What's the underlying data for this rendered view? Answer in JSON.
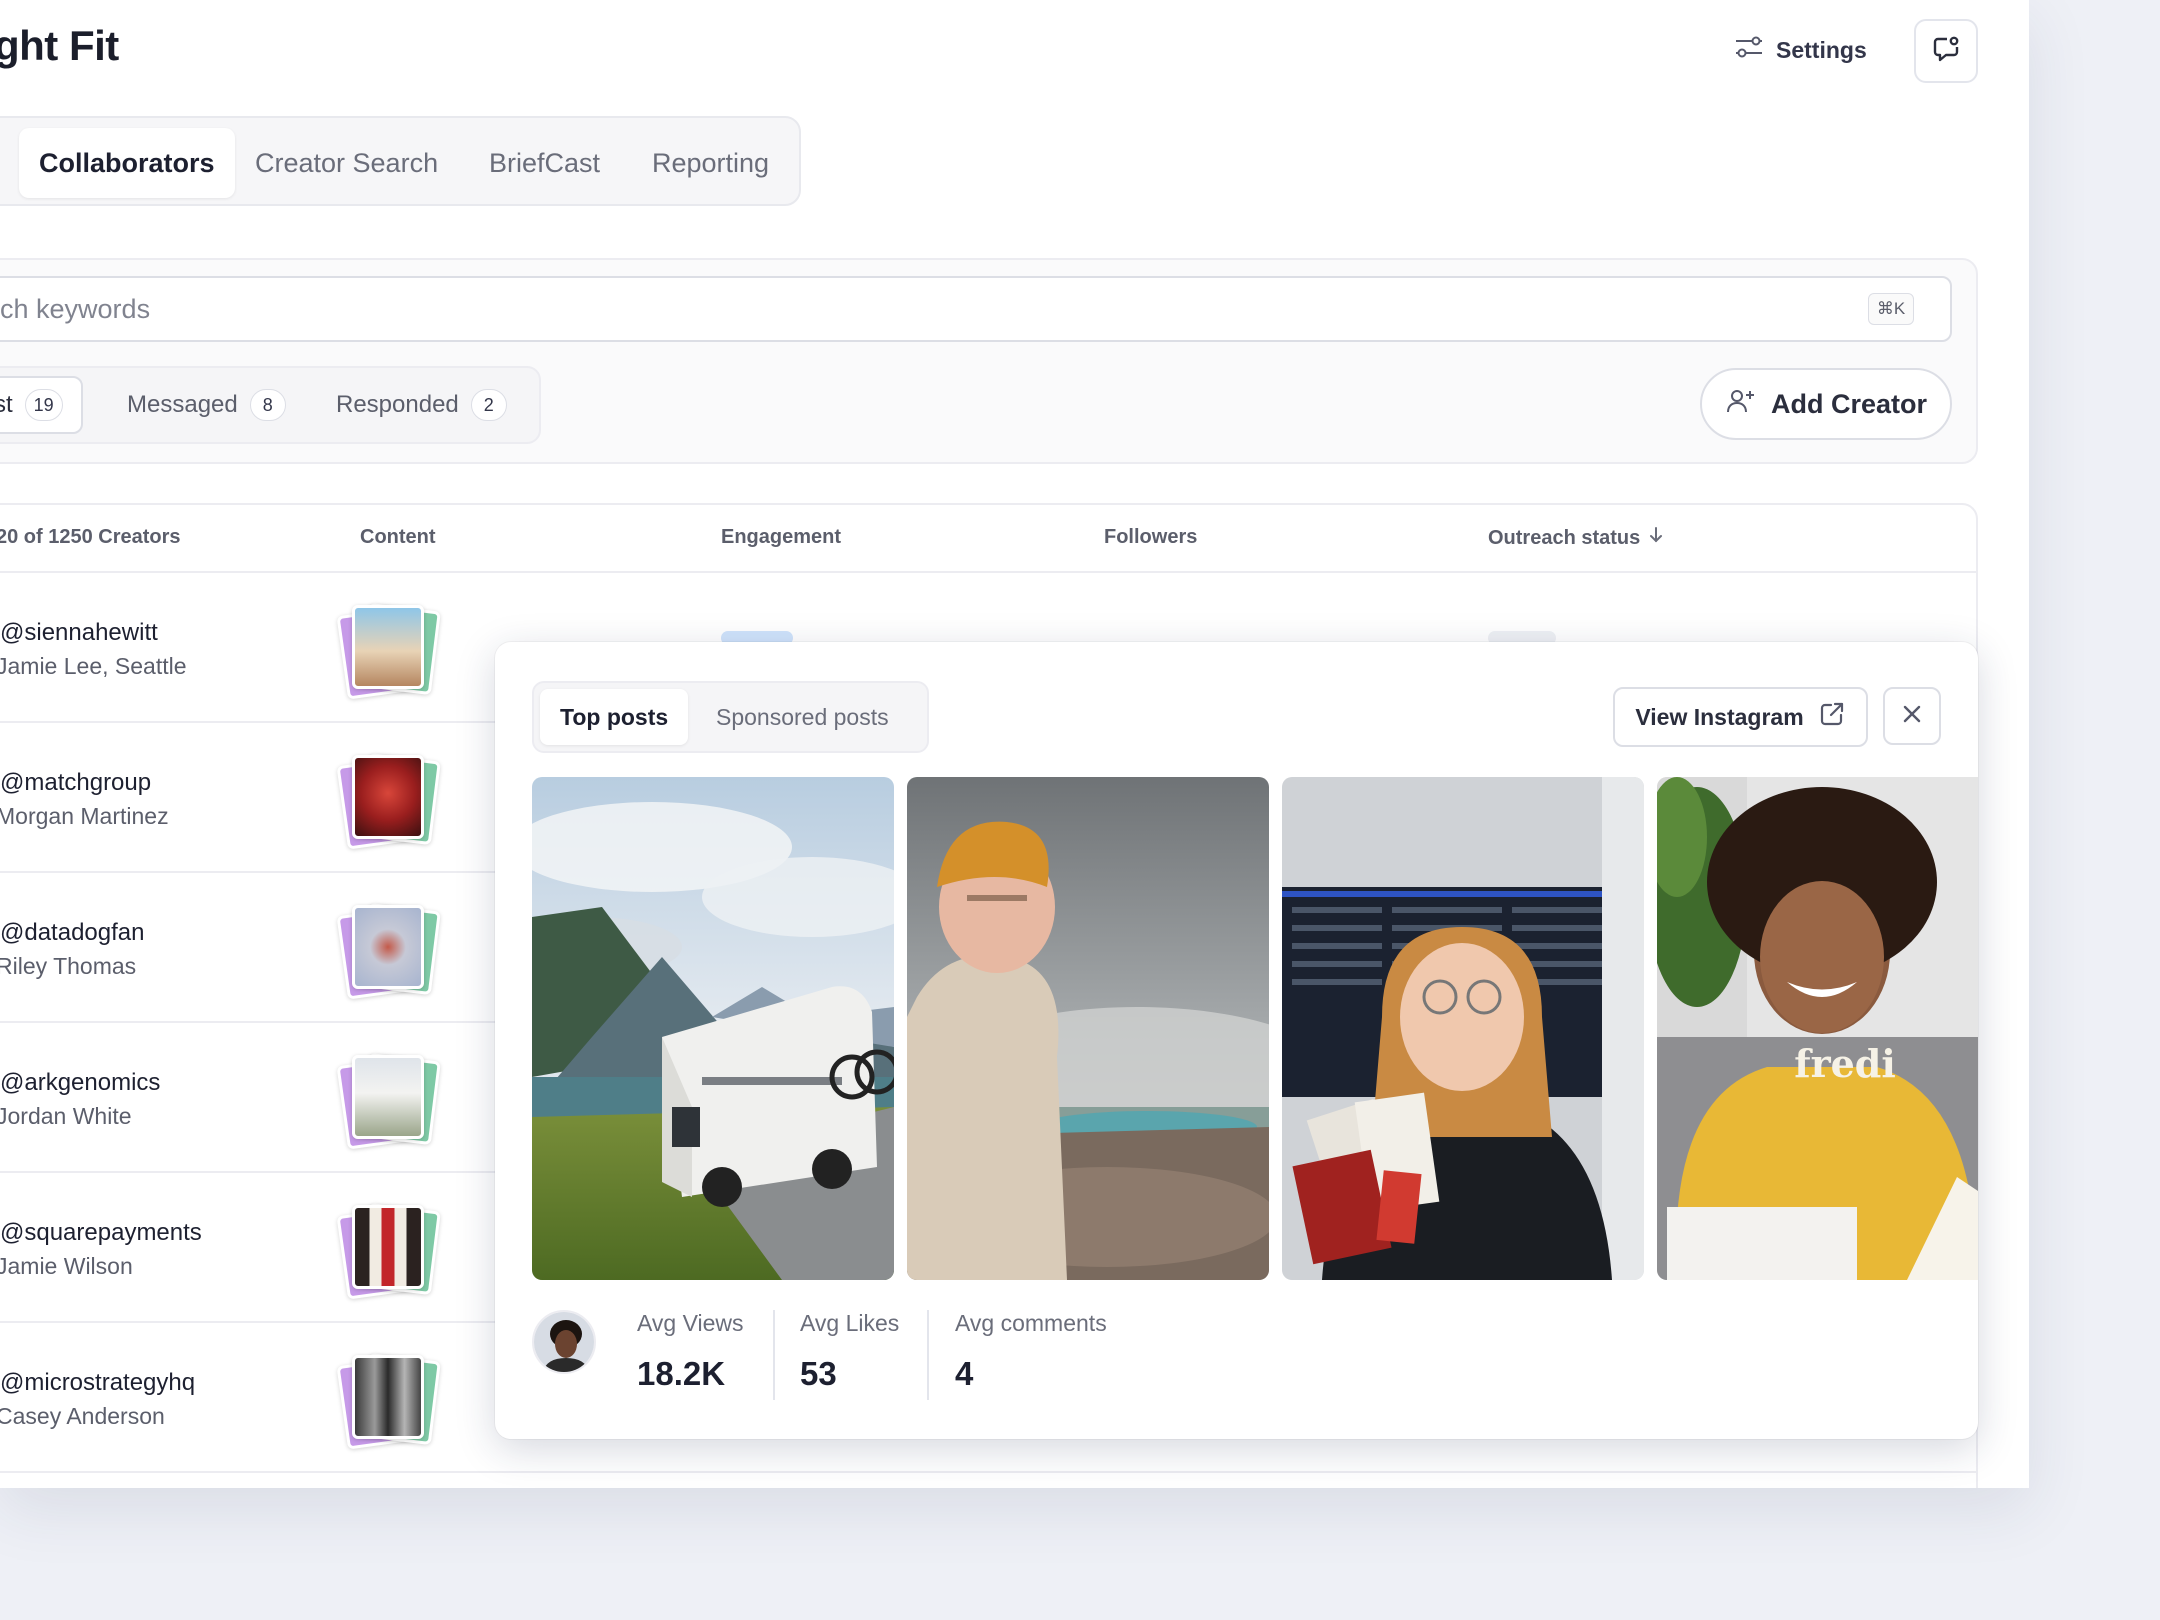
{
  "header": {
    "title": "ght Fit",
    "settings_label": "Settings"
  },
  "tabs": [
    {
      "label": "Collaborators",
      "active": true
    },
    {
      "label": "Creator Search"
    },
    {
      "label": "BriefCast"
    },
    {
      "label": "Reporting"
    }
  ],
  "search": {
    "placeholder": "arch keywords",
    "shortcut": "⌘K"
  },
  "segments": [
    {
      "label": "st",
      "count": "19",
      "active": true
    },
    {
      "label": "Messaged",
      "count": "8"
    },
    {
      "label": "Responded",
      "count": "2"
    }
  ],
  "add_creator_label": "Add Creator",
  "table": {
    "columns": [
      "20 of 1250 Creators",
      "Content",
      "Engagement",
      "Followers",
      "Outreach status"
    ],
    "rows": [
      {
        "handle": "@siennahewitt",
        "name": "Jamie Lee, Seattle"
      },
      {
        "handle": "@matchgroup",
        "name": "Morgan Martinez"
      },
      {
        "handle": "@datadogfan",
        "name": "Riley Thomas"
      },
      {
        "handle": "@arkgenomics",
        "name": "Jordan White"
      },
      {
        "handle": "@squarepayments",
        "name": "Jamie Wilson"
      },
      {
        "handle": "@microstrategyhq",
        "name": "Casey Anderson"
      }
    ]
  },
  "popover": {
    "tabs": [
      {
        "label": "Top posts",
        "active": true
      },
      {
        "label": "Sponsored posts"
      }
    ],
    "view_instagram_label": "View Instagram",
    "stats": [
      {
        "label": "Avg Views",
        "value": "18.2K"
      },
      {
        "label": "Avg Likes",
        "value": "53"
      },
      {
        "label": "Avg comments",
        "value": "4"
      }
    ],
    "post_4_text": "fredi"
  },
  "colors": {
    "accent_blue": "#cfe3fb",
    "tag_grey": "#eef0f4",
    "card_purple": "#c69ae8",
    "card_green": "#7ec9a5"
  },
  "icons": {
    "settings": "sliders-icon",
    "chat": "message-notification-icon",
    "add_creator": "user-plus-icon",
    "sort": "arrow-down-icon",
    "external": "external-link-icon",
    "close": "close-icon"
  }
}
